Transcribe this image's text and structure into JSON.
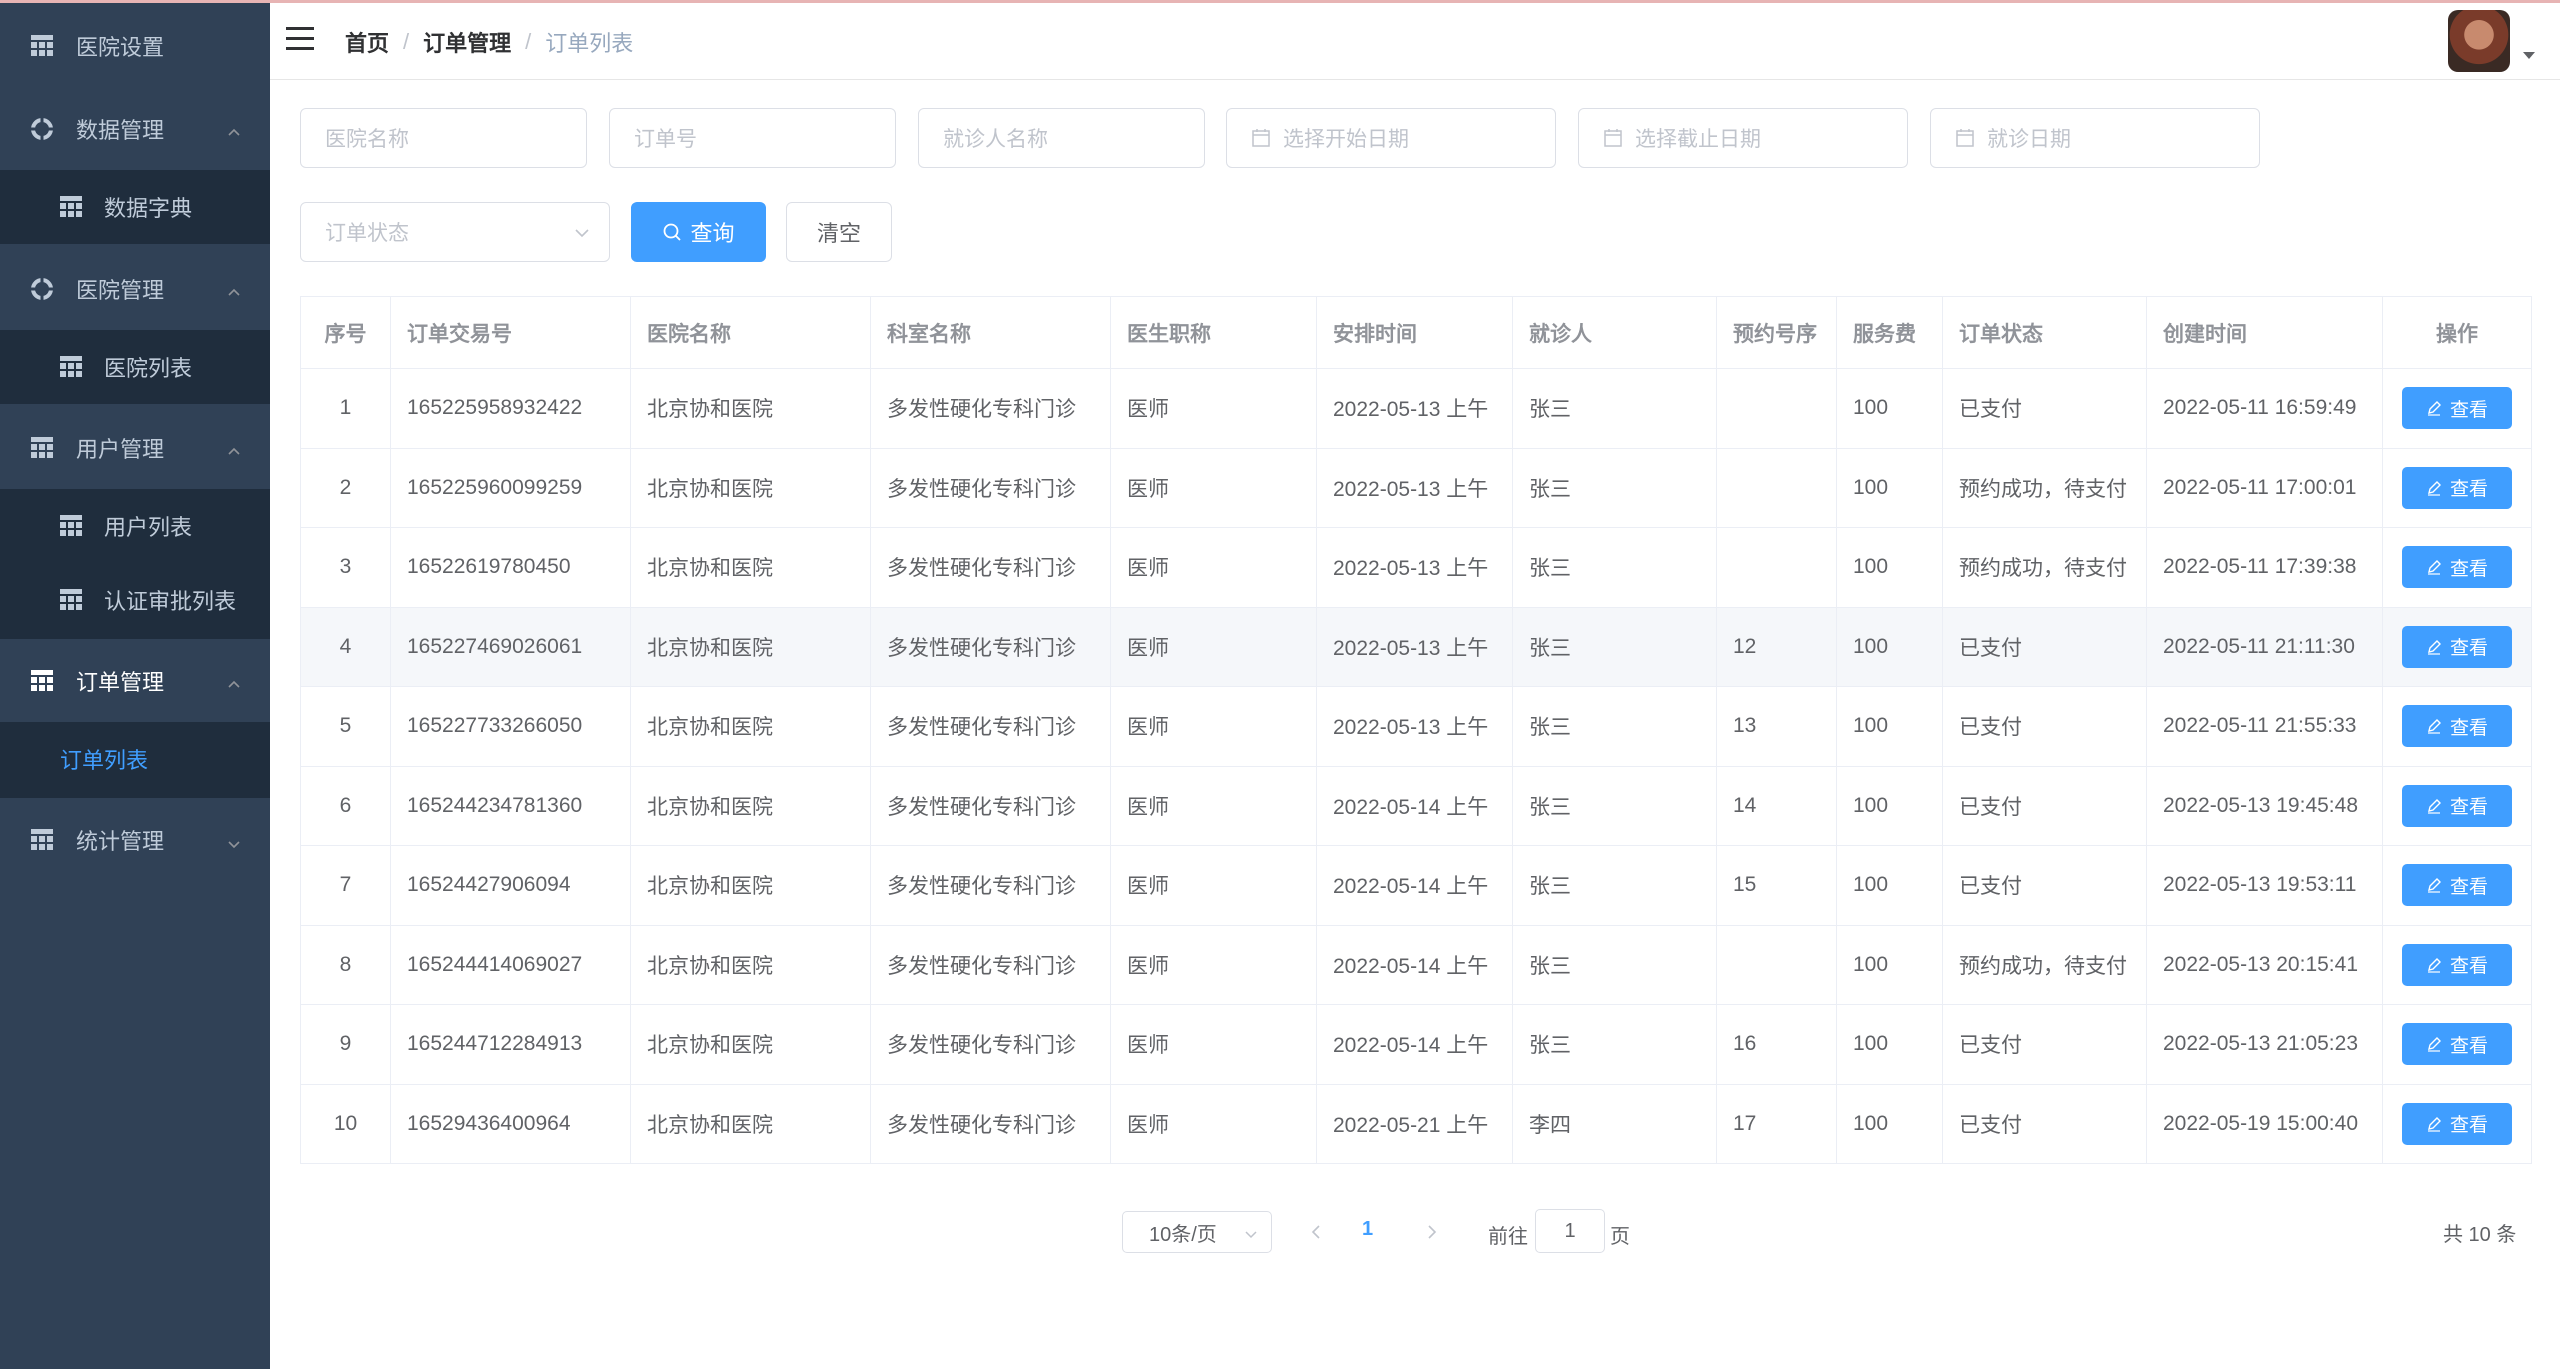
{
  "sidebar": {
    "items": [
      {
        "label": "医院设置"
      },
      {
        "label": "数据管理",
        "children": [
          {
            "label": "数据字典"
          }
        ]
      },
      {
        "label": "医院管理",
        "children": [
          {
            "label": "医院列表"
          }
        ]
      },
      {
        "label": "用户管理",
        "children": [
          {
            "label": "用户列表"
          },
          {
            "label": "认证审批列表"
          }
        ]
      },
      {
        "label": "订单管理",
        "children": [
          {
            "label": "订单列表"
          }
        ]
      },
      {
        "label": "统计管理"
      }
    ]
  },
  "header": {
    "breadcrumb": [
      "首页",
      "订单管理",
      "订单列表"
    ],
    "separator": "/"
  },
  "filters": {
    "hospital_name": "医院名称",
    "order_no": "订单号",
    "patient_name": "就诊人名称",
    "start_date": "选择开始日期",
    "end_date": "选择截止日期",
    "visit_date": "就诊日期",
    "order_status": "订单状态",
    "query_label": "查询",
    "clear_label": "清空"
  },
  "table": {
    "columns": [
      "序号",
      "订单交易号",
      "医院名称",
      "科室名称",
      "医生职称",
      "安排时间",
      "就诊人",
      "预约号序",
      "服务费",
      "订单状态",
      "创建时间",
      "操作"
    ],
    "rows": [
      [
        "1",
        "165225958932422",
        "北京协和医院",
        "多发性硬化专科门诊",
        "医师",
        "2022-05-13 上午",
        "张三",
        "",
        "100",
        "已支付",
        "2022-05-11 16:59:49"
      ],
      [
        "2",
        "165225960099259",
        "北京协和医院",
        "多发性硬化专科门诊",
        "医师",
        "2022-05-13 上午",
        "张三",
        "",
        "100",
        "预约成功，待支付",
        "2022-05-11 17:00:01"
      ],
      [
        "3",
        "16522619780450",
        "北京协和医院",
        "多发性硬化专科门诊",
        "医师",
        "2022-05-13 上午",
        "张三",
        "",
        "100",
        "预约成功，待支付",
        "2022-05-11 17:39:38"
      ],
      [
        "4",
        "165227469026061",
        "北京协和医院",
        "多发性硬化专科门诊",
        "医师",
        "2022-05-13 上午",
        "张三",
        "12",
        "100",
        "已支付",
        "2022-05-11 21:11:30"
      ],
      [
        "5",
        "165227733266050",
        "北京协和医院",
        "多发性硬化专科门诊",
        "医师",
        "2022-05-13 上午",
        "张三",
        "13",
        "100",
        "已支付",
        "2022-05-11 21:55:33"
      ],
      [
        "6",
        "165244234781360",
        "北京协和医院",
        "多发性硬化专科门诊",
        "医师",
        "2022-05-14 上午",
        "张三",
        "14",
        "100",
        "已支付",
        "2022-05-13 19:45:48"
      ],
      [
        "7",
        "16524427906094",
        "北京协和医院",
        "多发性硬化专科门诊",
        "医师",
        "2022-05-14 上午",
        "张三",
        "15",
        "100",
        "已支付",
        "2022-05-13 19:53:11"
      ],
      [
        "8",
        "165244414069027",
        "北京协和医院",
        "多发性硬化专科门诊",
        "医师",
        "2022-05-14 上午",
        "张三",
        "",
        "100",
        "预约成功，待支付",
        "2022-05-13 20:15:41"
      ],
      [
        "9",
        "165244712284913",
        "北京协和医院",
        "多发性硬化专科门诊",
        "医师",
        "2022-05-14 上午",
        "张三",
        "16",
        "100",
        "已支付",
        "2022-05-13 21:05:23"
      ],
      [
        "10",
        "16529436400964",
        "北京协和医院",
        "多发性硬化专科门诊",
        "医师",
        "2022-05-21 上午",
        "李四",
        "17",
        "100",
        "已支付",
        "2022-05-19 15:00:40"
      ]
    ],
    "view_label": "查看"
  },
  "pagination": {
    "page_size": "10条/页",
    "current_page": "1",
    "goto_label": "前往",
    "goto_value": "1",
    "page_suffix": "页",
    "total": "共 10 条"
  },
  "colors": {
    "sidebar_bg": "#304156",
    "submenu_bg": "#1f2d3d",
    "primary": "#409eff"
  }
}
